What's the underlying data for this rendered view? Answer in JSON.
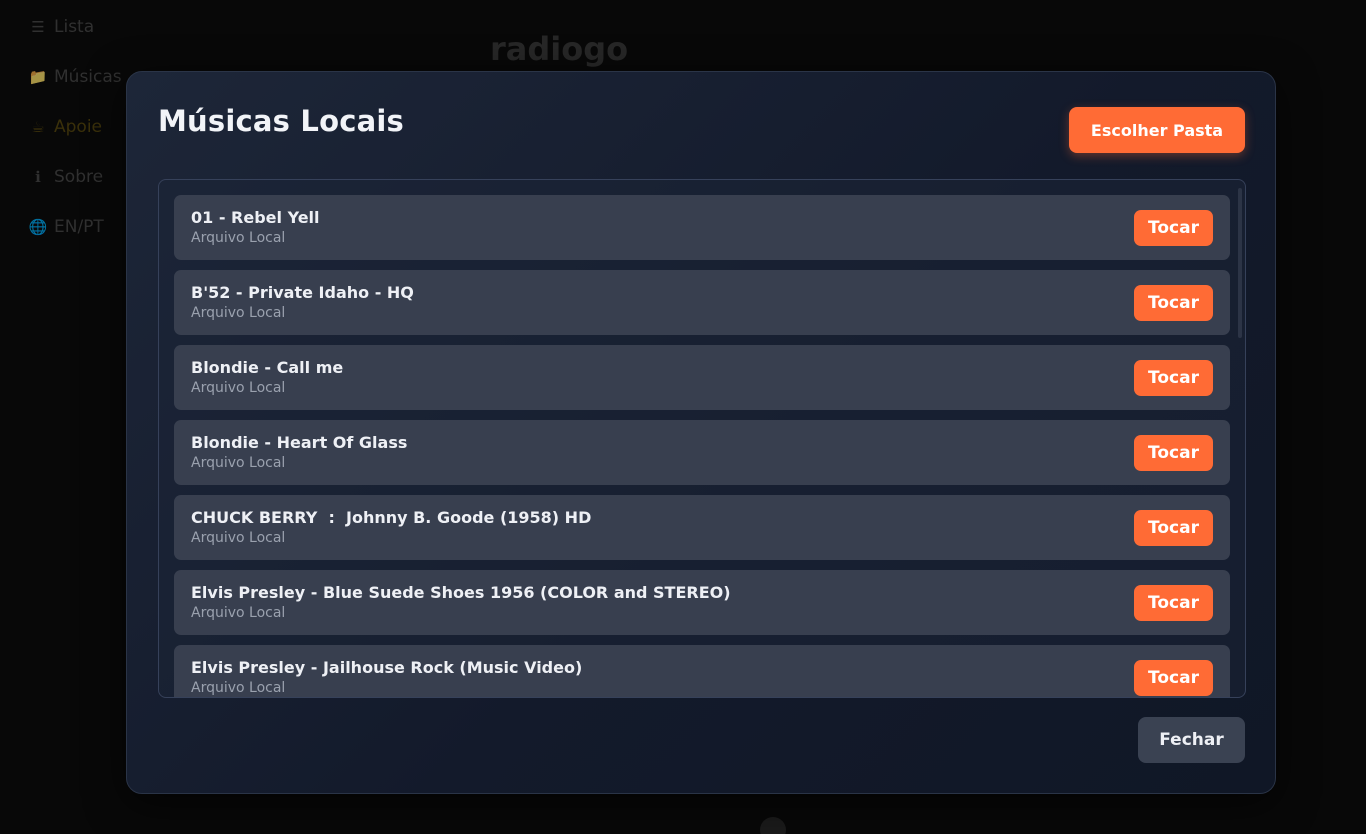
{
  "app": {
    "logo": "radiogo"
  },
  "sidebar": {
    "items": [
      {
        "icon": "☰",
        "icon_name": "list-icon",
        "label": "Lista"
      },
      {
        "icon": "📁",
        "icon_name": "folder-icon",
        "label": "Músicas"
      },
      {
        "icon": "☕",
        "icon_name": "coffee-icon",
        "label": "Apoie"
      },
      {
        "icon": "ℹ",
        "icon_name": "info-icon",
        "label": "Sobre"
      },
      {
        "icon": "🌐",
        "icon_name": "globe-icon",
        "label": "EN/PT"
      }
    ]
  },
  "modal": {
    "title": "Músicas Locais",
    "choose_folder_label": "Escolher Pasta",
    "close_label": "Fechar",
    "tracks": [
      {
        "title": "01 - Rebel Yell",
        "source": "Arquivo Local",
        "play_label": "Tocar"
      },
      {
        "title": "B'52 - Private Idaho - HQ",
        "source": "Arquivo Local",
        "play_label": "Tocar"
      },
      {
        "title": "Blondie - Call me",
        "source": "Arquivo Local",
        "play_label": "Tocar"
      },
      {
        "title": "Blondie - Heart Of Glass",
        "source": "Arquivo Local",
        "play_label": "Tocar"
      },
      {
        "title": "CHUCK BERRY  :  Johnny B. Goode (1958) HD",
        "source": "Arquivo Local",
        "play_label": "Tocar"
      },
      {
        "title": "Elvis Presley - Blue Suede Shoes 1956 (COLOR and STEREO)",
        "source": "Arquivo Local",
        "play_label": "Tocar"
      },
      {
        "title": "Elvis Presley - Jailhouse Rock (Music Video)",
        "source": "Arquivo Local",
        "play_label": "Tocar"
      }
    ]
  },
  "colors": {
    "accent": "#ff6b35",
    "modal_bg": "#161e2f",
    "row_bg": "#383f4f"
  }
}
